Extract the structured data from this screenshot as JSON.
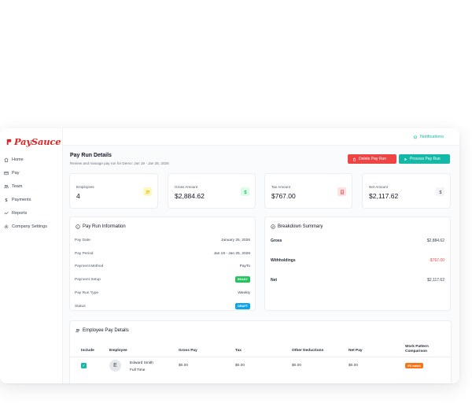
{
  "brand": {
    "name": "PaySauce",
    "color": "#dc2626"
  },
  "sidebar": {
    "items": [
      {
        "label": "Home",
        "icon": "home-icon"
      },
      {
        "label": "Pay",
        "icon": "card-icon"
      },
      {
        "label": "Team",
        "icon": "users-icon"
      },
      {
        "label": "Payments",
        "icon": "dollar-icon"
      },
      {
        "label": "Reports",
        "icon": "chart-icon"
      },
      {
        "label": "Company Settings",
        "icon": "gear-icon"
      }
    ]
  },
  "topbar": {
    "notifications_label": "Notifications"
  },
  "header": {
    "title": "Pay Run Details",
    "subtitle": "Review and manage pay run for Demo: Jan 19 - Jan 25, 2026",
    "delete_label": "Delete Pay Run",
    "process_label": "Process Pay Run"
  },
  "stats": [
    {
      "label": "Employees",
      "value": "4",
      "icon": "users-icon",
      "icon_color": "#eab308",
      "icon_bg": "#fef9c3"
    },
    {
      "label": "Gross Amount",
      "value": "$2,884.62",
      "icon": "dollar-icon",
      "icon_color": "#22c55e",
      "icon_bg": "#dcfce7"
    },
    {
      "label": "Tax Amount",
      "value": "$767.00",
      "icon": "receipt-icon",
      "icon_color": "#ef4444",
      "icon_bg": "#fee2e2"
    },
    {
      "label": "Net Amount",
      "value": "$2,117.62",
      "icon": "dollar-icon",
      "icon_color": "#6b7280",
      "icon_bg": "#f3f4f6"
    }
  ],
  "pay_run_info": {
    "title": "Pay Run Information",
    "rows": [
      {
        "label": "Pay Date",
        "value": "January 25, 2026"
      },
      {
        "label": "Pay Period",
        "value": "Jan 19 - Jan 25, 2026"
      },
      {
        "label": "Payment Method",
        "value": "PayTo"
      },
      {
        "label": "Payment Setup",
        "value": "READY"
      },
      {
        "label": "Pay Run Type",
        "value": "Weekly"
      },
      {
        "label": "Status",
        "value": "DRAFT"
      }
    ]
  },
  "breakdown": {
    "title": "Breakdown Summary",
    "rows": [
      {
        "label": "Gross",
        "value": "$2,884.62"
      },
      {
        "label": "Withholdings",
        "value": "-$767.00"
      },
      {
        "label": "Net",
        "value": "$2,117.62"
      }
    ]
  },
  "employee_details": {
    "title": "Employee Pay Details",
    "columns": [
      "Include",
      "Employee",
      "Gross Pay",
      "Tax",
      "Other Deductions",
      "Net Pay",
      "Work Pattern Comparison"
    ],
    "rows": [
      {
        "initial": "E",
        "name": "Edward Smith",
        "type": "Full Time",
        "gross": "$0.00",
        "tax": "$0.00",
        "other": "$0.00",
        "net": "$0.00",
        "match": "0% match"
      }
    ]
  },
  "colors": {
    "accent": "#14b8a6",
    "danger": "#ef4444",
    "ready": "#22c55e",
    "draft": "#0ea5e9",
    "match": "#f97316"
  }
}
